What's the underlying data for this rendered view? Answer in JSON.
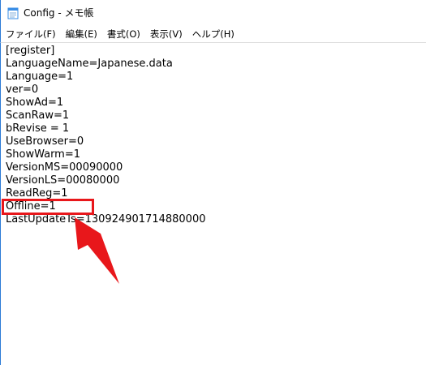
{
  "window": {
    "title": "Config - メモ帳",
    "icon": "notepad-icon"
  },
  "menu": [
    "ファイル(F)",
    "編集(E)",
    "書式(O)",
    "表示(V)",
    "ヘルプ(H)"
  ],
  "document": {
    "lines": [
      "[register]",
      "LanguageName=Japanese.data",
      "Language=1",
      "ver=0",
      "ShowAd=1",
      "ScanRaw=1",
      "bRevise = 1",
      "UseBrowser=0",
      "ShowWarm=1",
      "VersionMS=00090000",
      "VersionLS=00080000",
      "ReadReg=1",
      "Offline=1",
      "LastUpdateTs=130924901714880000"
    ],
    "highlighted_line_index": 12
  },
  "annotation": {
    "box_color": "#e8171b",
    "arrow_color": "#e8171b"
  }
}
